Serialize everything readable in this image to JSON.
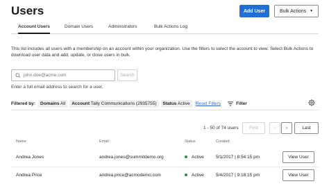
{
  "header": {
    "title": "Users",
    "add_user_label": "Add User",
    "bulk_actions_label": "Bulk Actions"
  },
  "tabs": [
    {
      "label": "Account Users",
      "active": true
    },
    {
      "label": "Domain Users",
      "active": false
    },
    {
      "label": "Administrators",
      "active": false
    },
    {
      "label": "Bulk Actions Log",
      "active": false
    }
  ],
  "description": "This list includes all users with a membership on an account within your organization. Use the filters to select the account to view. Select Bulk Actions to download user data and add, update, or close users in bulk.",
  "search": {
    "placeholder": "john.doe@acme.com",
    "button_label": "Search",
    "hint": "Enter a full email address to search for a user."
  },
  "filters": {
    "label": "Filtered by:",
    "domains_key": "Domains",
    "domains_value": "All",
    "account_key": "Account",
    "account_value": "Tally Communications (2935755)",
    "status_key": "Status",
    "status_value": "Active",
    "reset_label": "Reset Filters",
    "filter_label": "Filter"
  },
  "pagination": {
    "summary": "1 - 50 of 74 users",
    "first_label": "First",
    "prev_icon": "‹",
    "next_icon": "›",
    "last_label": "Last"
  },
  "table": {
    "columns": [
      "Name",
      "Email",
      "Status",
      "Created"
    ],
    "action_label": "View User",
    "rows": [
      {
        "name": "Andrea Jones",
        "email": "andrea.jones@summitdemo.org",
        "status": "Active",
        "created": "5/1/2017 | 8:54:15 pm"
      },
      {
        "name": "Andrea Price",
        "email": "andrea.price@acmodemo.com",
        "status": "Active",
        "created": "5/4/2017 | 9:18:15 pm"
      }
    ]
  },
  "colors": {
    "primary": "#1f6fd6",
    "active_status": "#2d8f3e"
  }
}
